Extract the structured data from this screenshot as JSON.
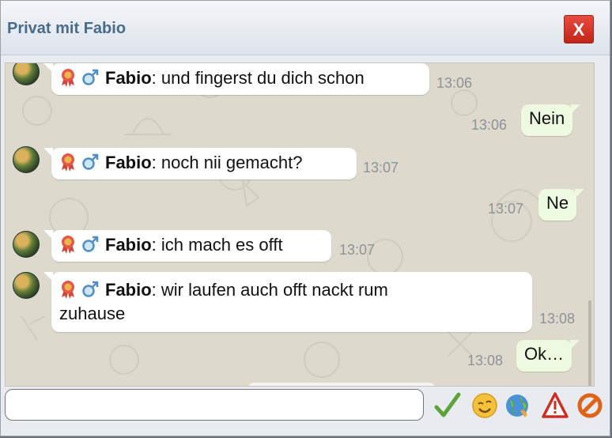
{
  "window": {
    "title": "Privat mit Fabio",
    "close_label": "X"
  },
  "messages": [
    {
      "dir": "in",
      "sender": "Fabio",
      "text": ": und fingerst du dich schon",
      "time": "13:06"
    },
    {
      "dir": "out",
      "text": "Nein",
      "time": "13:06"
    },
    {
      "dir": "in",
      "sender": "Fabio",
      "text": ": noch nii gemacht?",
      "time": "13:07"
    },
    {
      "dir": "out",
      "text": "Ne",
      "time": "13:07"
    },
    {
      "dir": "in",
      "sender": "Fabio",
      "text": ": ich mach es offt",
      "time": "13:07"
    },
    {
      "dir": "in",
      "sender": "Fabio",
      "text": ": wir laufen auch offt nackt rum",
      "text2": "zuhause",
      "time": "13:08"
    },
    {
      "dir": "out",
      "text": "Ok…",
      "time": "13:08"
    }
  ],
  "composer": {
    "value": "",
    "placeholder": ""
  },
  "toolbar": {
    "icons": [
      "send-check-icon",
      "smiley-icon",
      "globe-icon",
      "warning-icon",
      "block-icon"
    ]
  },
  "colors": {
    "title": "#486b8c",
    "close": "#d63a2d",
    "out_bubble": "#eefadf",
    "chat_bg": "#ddd9cc"
  }
}
